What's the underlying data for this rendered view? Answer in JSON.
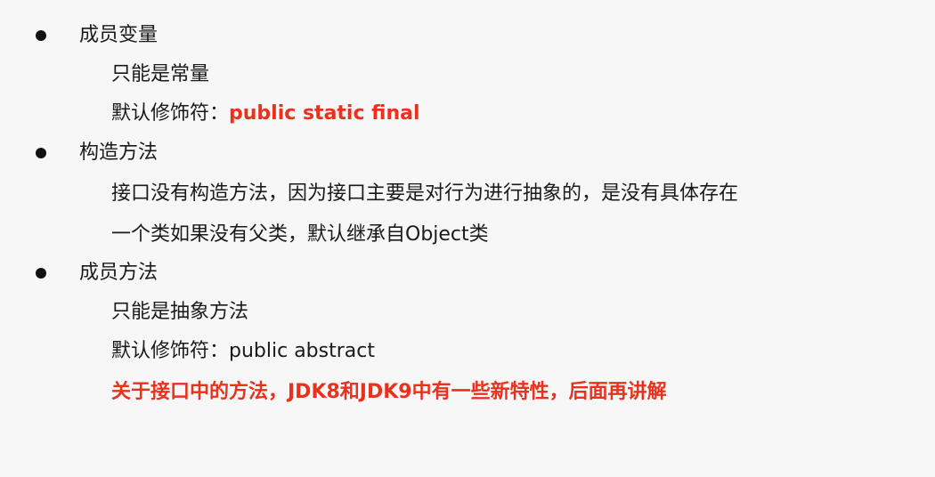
{
  "sections": [
    {
      "title": "成员变量",
      "lines": [
        {
          "text": "只能是常量"
        },
        {
          "label": "默认修饰符：",
          "value": "public static final",
          "value_color": "#e8321e"
        }
      ]
    },
    {
      "title": "构造方法",
      "lines": [
        {
          "text": "接口没有构造方法，因为接口主要是对行为进行抽象的，是没有具体存在"
        },
        {
          "text": "一个类如果没有父类，默认继承自Object类"
        }
      ]
    },
    {
      "title": "成员方法",
      "lines": [
        {
          "text": "只能是抽象方法"
        },
        {
          "label": "默认修饰符：",
          "value": "public abstract"
        },
        {
          "text": "关于接口中的方法，JDK8和JDK9中有一些新特性，后面再讲解",
          "color": "#e8321e"
        }
      ]
    }
  ]
}
